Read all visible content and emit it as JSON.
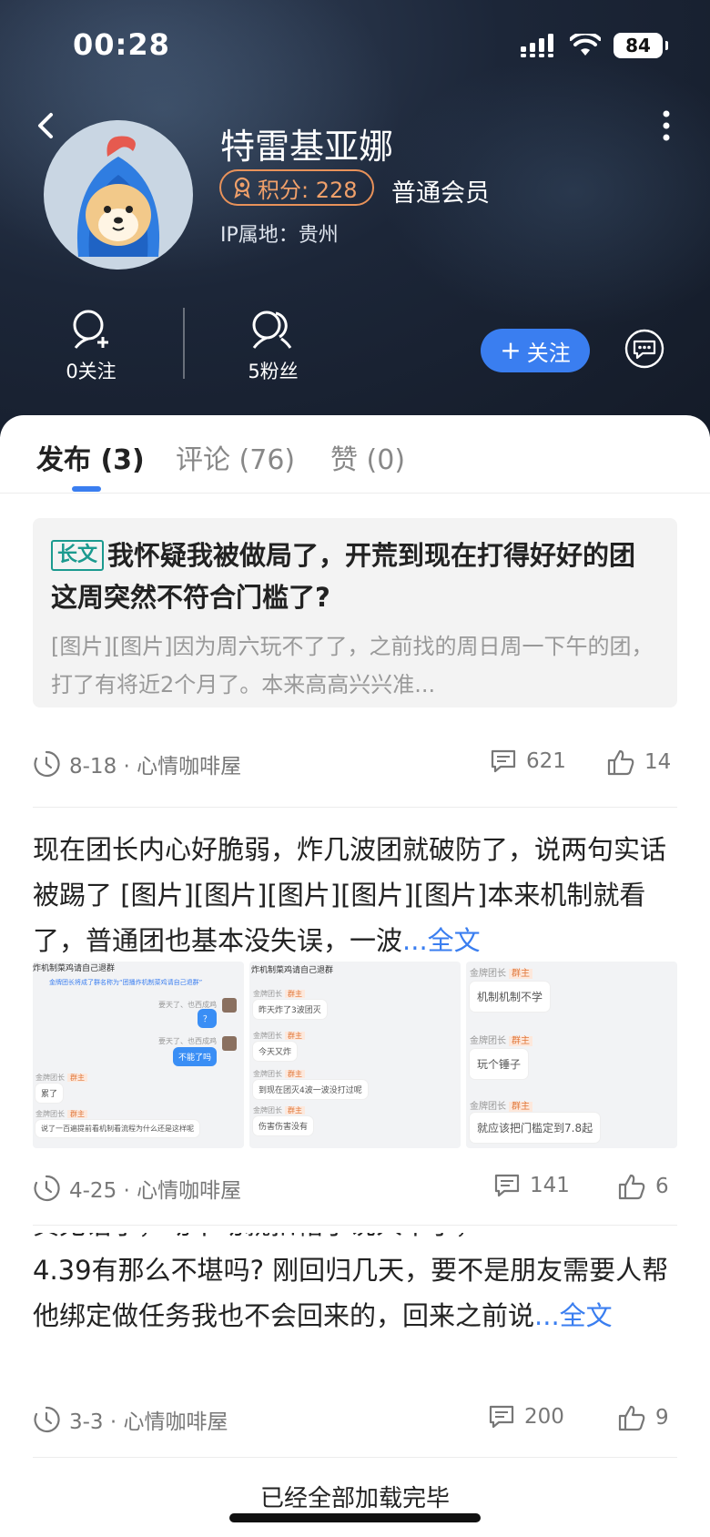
{
  "status_bar": {
    "time": "00:28",
    "battery": "84"
  },
  "profile": {
    "name": "特雷基亚娜",
    "points_label": "积分: 228",
    "member_level": "普通会员",
    "ip_location": "IP属地：贵州",
    "following": "0关注",
    "followers": "5粉丝",
    "follow_button": "关注"
  },
  "tabs": [
    {
      "label": "发布 (3)",
      "active": true
    },
    {
      "label": "评论 (76)",
      "active": false
    },
    {
      "label": "赞 (0)",
      "active": false
    }
  ],
  "posts": [
    {
      "tag": "长文",
      "title": "我怀疑我被做局了，开荒到现在打得好好的团这周突然不符合门槛了?",
      "summary": "[图片][图片]因为周六玩不了了，之前找的周日周一下午的团，打了有将近2个月了。本来高高兴兴准...",
      "date": "8-18 · 心情咖啡屋",
      "comments": "621",
      "likes": "14"
    },
    {
      "text": "现在团长内心好脆弱，炸几波团就破防了，说两句实话被踢了 [图片][图片][图片][图片][图片]本来机制就看了，普通团也基本没失误，一波",
      "more": "...全文",
      "images": {
        "img1": {
          "header": "炸机制菜鸡请自己退群",
          "line1": "金牌团长将成了群名称为“团播炸机制菜鸡请自己退群”",
          "sender_a": "要天了、也西成鸡",
          "bubble_a": "？",
          "bubble_b": "不能了吗",
          "sender_gold": "金牌团长",
          "role": "群主",
          "msg1": "累了",
          "msg2": "说了一百遍提前看机制看流程为什么还是这样呢"
        },
        "img2": {
          "header": "炸机制菜鸡请自己退群",
          "sender_gold": "金牌团长",
          "role": "群主",
          "msg1": "昨天炸了3波团灭",
          "msg2": "今天又炸",
          "msg3": "到现在团灭4波一波没打过呢",
          "msg4": "伤害伤害没有"
        },
        "img3": {
          "sender_gold": "金牌团长",
          "role": "群主",
          "msg1": "机制机制不学",
          "msg2": "玩个锤子",
          "msg3": "就应该把门槛定到7.8起"
        }
      },
      "date": "4-25 · 心情咖啡屋",
      "comments": "141",
      "likes": "6"
    },
    {
      "text_top": "真无语了，动不动就扣帽子说人串子，",
      "text": "4.39有那么不堪吗? 刚回归几天，要不是朋友需要人帮他绑定做任务我也不会回来的，回来之前说",
      "more": "...全文",
      "date": "3-3 · 心情咖啡屋",
      "comments": "200",
      "likes": "9"
    }
  ],
  "footer": {
    "loaded_text": "已经全部加载完毕"
  },
  "colors": {
    "accent": "#3a7ef0",
    "points": "#e8925a",
    "long_tag": "#1b9a8f"
  }
}
